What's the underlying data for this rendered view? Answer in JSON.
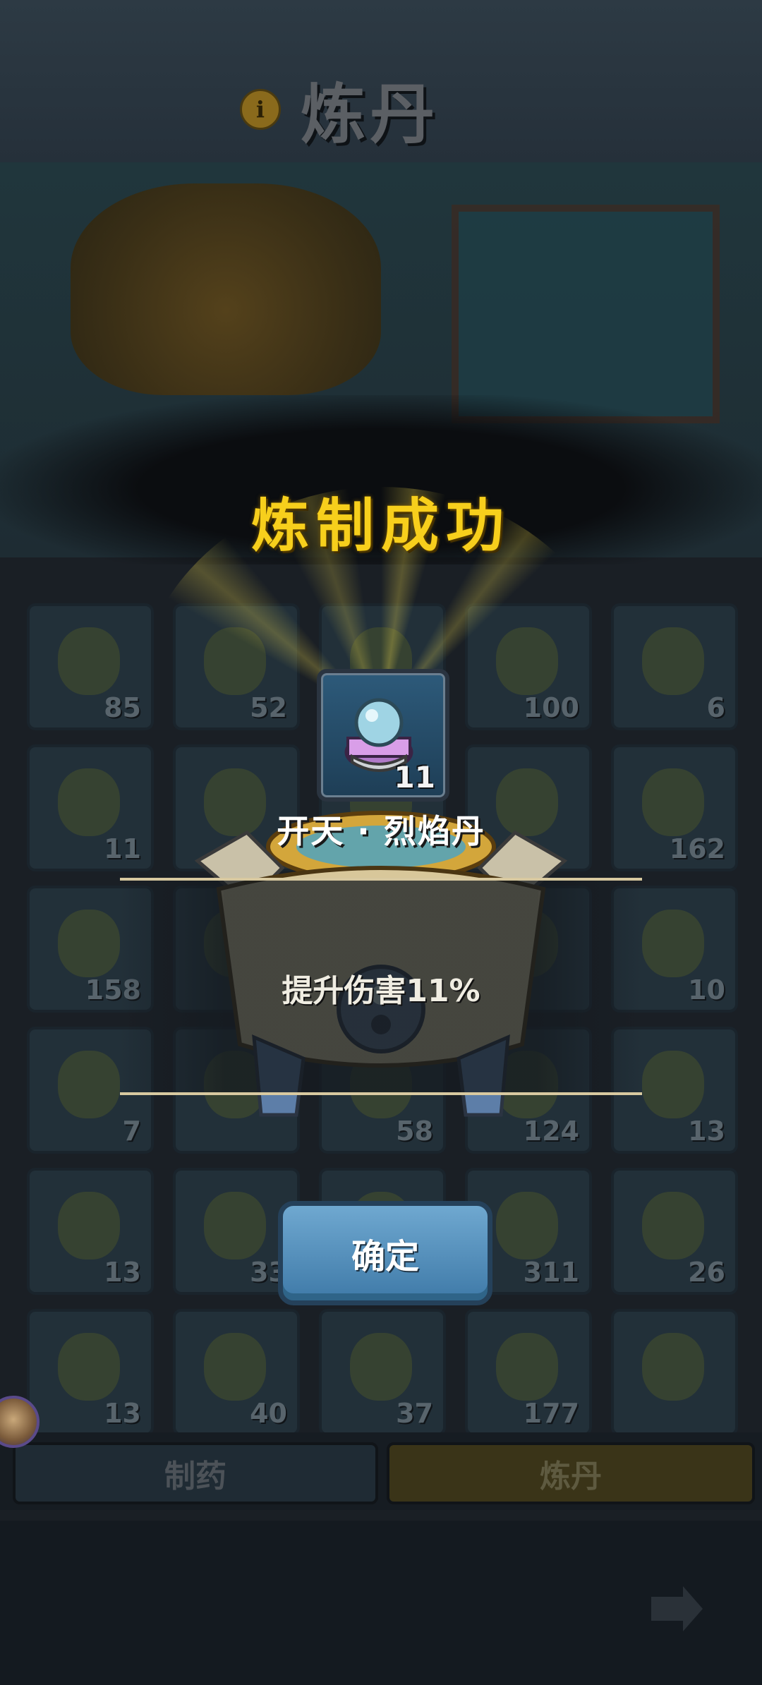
{
  "header": {
    "title": "炼丹",
    "info_icon": "info-icon",
    "info_label": "i"
  },
  "inventory": {
    "counts": [
      "85",
      "52",
      "",
      "100",
      "6",
      "11",
      "",
      "",
      "",
      "162",
      "158",
      "",
      "",
      "",
      "10",
      "7",
      "",
      "58",
      "124",
      "13",
      "13",
      "33",
      "",
      "311",
      "26",
      "13",
      "40",
      "37",
      "177",
      ""
    ]
  },
  "tabs": {
    "left": "制药",
    "right": "炼丹"
  },
  "result": {
    "title": "炼制成功",
    "item_count": "11",
    "item_name": "开天 · 烈焰丹",
    "description": "提升伤害11%",
    "confirm_label": "确定"
  },
  "icons": [
    "info-icon",
    "elixir-icon",
    "back-arrow-icon",
    "avatar-icon"
  ],
  "colors": {
    "title_gold": "#f7cf1c",
    "confirm_blue": "#4f8bb8",
    "background": "#1a1f25"
  }
}
